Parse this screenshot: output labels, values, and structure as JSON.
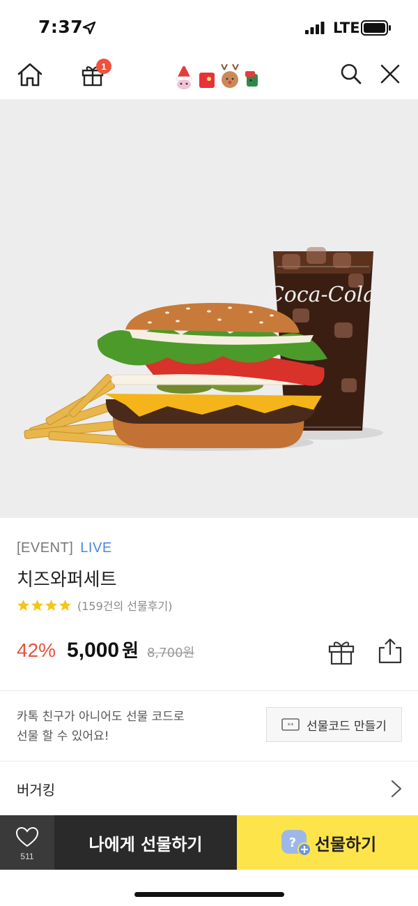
{
  "status_bar": {
    "time": "7:37",
    "network": "LTE"
  },
  "nav": {
    "home_icon": "home-icon",
    "gift_icon": "gift-icon",
    "gift_badge": "1",
    "search_icon": "search-icon",
    "close_icon": "close-icon"
  },
  "product": {
    "tag": "[EVENT]",
    "live": "LIVE",
    "name": "치즈와퍼세트",
    "rating_stars": 4,
    "review_count": "(159건의 선물후기)",
    "discount": "42%",
    "price": "5,000",
    "price_unit": "원",
    "original_price": "8,700원"
  },
  "gift_code": {
    "line1": "카톡 친구가 아니어도 선물 코드로",
    "line2": "선물 할 수 있어요!",
    "button_label": "선물코드 만들기"
  },
  "brand": {
    "name": "버거킹"
  },
  "bottom": {
    "like_count": "511",
    "self_gift_label": "나에게 선물하기",
    "gift_label": "선물하기"
  },
  "colors": {
    "accent_yellow": "#fde44a",
    "discount_red": "#e8523e",
    "live_blue": "#4d86e0",
    "dark_button": "#2a2a2a"
  }
}
